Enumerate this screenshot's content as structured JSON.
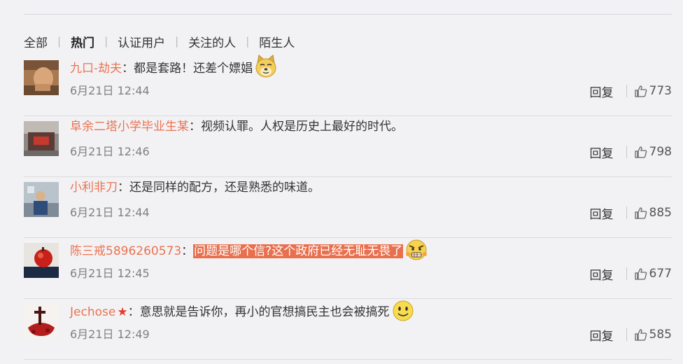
{
  "filters": [
    "全部",
    "热门",
    "认证用户",
    "关注的人",
    "陌生人"
  ],
  "active_filter": "热门",
  "reply_label": "回复",
  "comments": [
    {
      "user": "九口-劫夫",
      "colon": "：",
      "text": "都是套路！还差个嫖娼",
      "highlight": "",
      "tail": "",
      "emoji": "doge-icon",
      "time": "6月21日 12:44",
      "likes": "773"
    },
    {
      "user": "阜余二塔小学毕业生某",
      "colon": "：",
      "text": "视频认罪。人权是历史上最好的时代。",
      "highlight": "",
      "tail": "",
      "emoji": "",
      "time": "6月21日 12:46",
      "likes": "798"
    },
    {
      "user": "小利非刀",
      "colon": "：",
      "text": "还是同样的配方，还是熟悉的味道。",
      "highlight": "",
      "tail": "",
      "emoji": "",
      "time": "6月21日 12:44",
      "likes": "885"
    },
    {
      "user": "陈三戒5896260573",
      "colon": "：",
      "text": "",
      "highlight": "问题是哪个信?这个政府已经无耻无畏了",
      "tail": "",
      "emoji": "angry-face-icon",
      "time": "6月21日 12:45",
      "likes": "677"
    },
    {
      "user": "Jechose",
      "colon": "：",
      "text": "意思就是告诉你，再小的官想搞民主也会被搞死",
      "highlight": "",
      "tail": "",
      "emoji": "smile-face-icon",
      "time": "6月21日 12:49",
      "likes": "585",
      "badge": "star-icon"
    }
  ]
}
